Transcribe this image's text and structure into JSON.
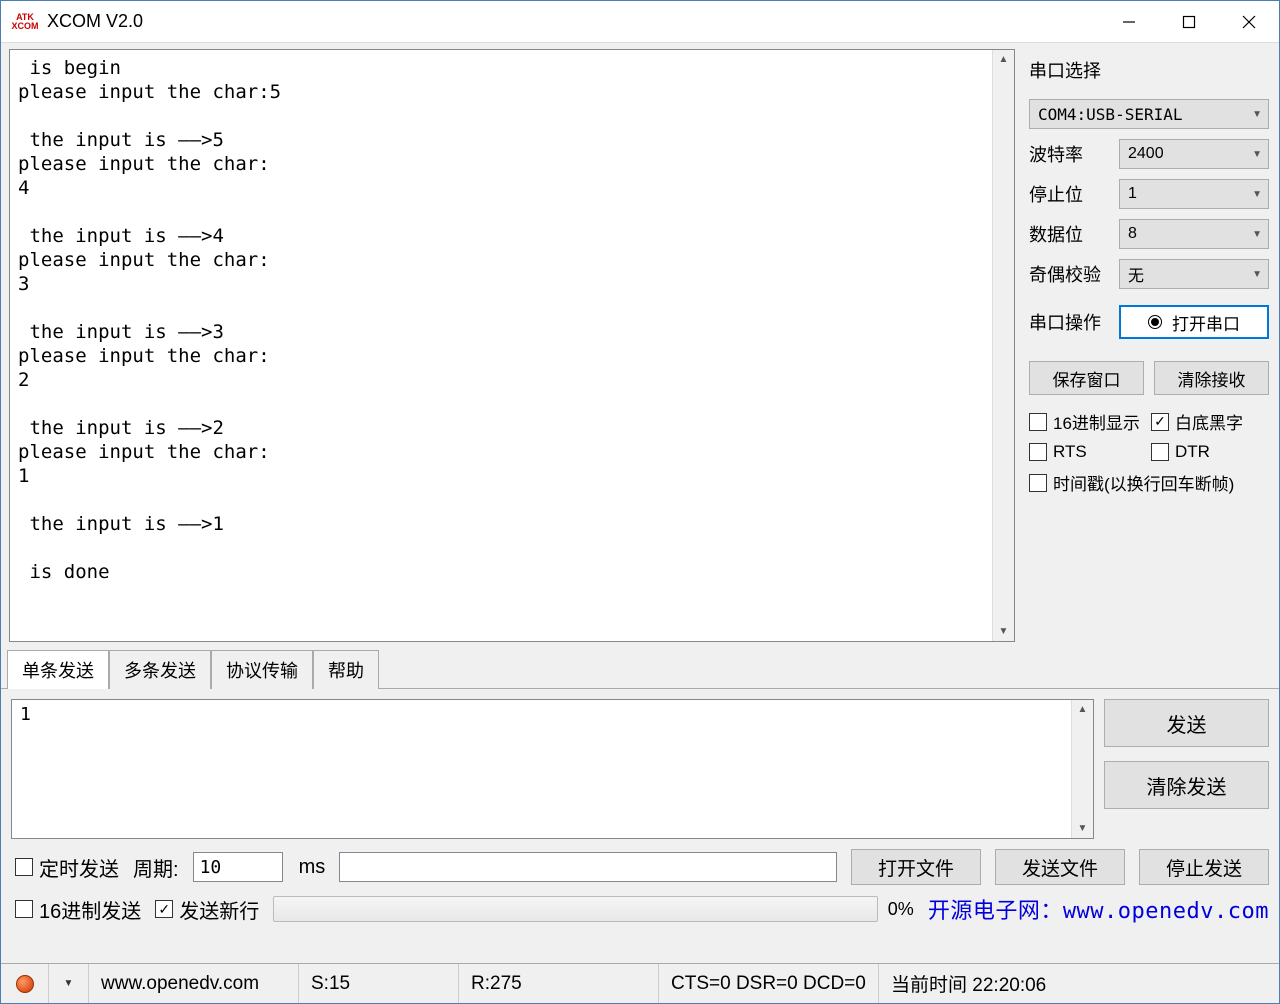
{
  "title": "XCOM V2.0",
  "logo": {
    "l1": "ATK",
    "l2": "XCOM"
  },
  "terminal": " is begin\nplease input the char:5\n\n the input is ——>5\nplease input the char:\n4\n\n the input is ——>4\nplease input the char:\n3\n\n the input is ——>3\nplease input the char:\n2\n\n the input is ——>2\nplease input the char:\n1\n\n the input is ——>1\n\n is done",
  "side": {
    "title": "串口选择",
    "port": "COM4:USB-SERIAL",
    "baud_lbl": "波特率",
    "baud": "2400",
    "stop_lbl": "停止位",
    "stop": "1",
    "data_lbl": "数据位",
    "data": "8",
    "parity_lbl": "奇偶校验",
    "parity": "无",
    "op_lbl": "串口操作",
    "op_btn": "打开串口",
    "save_btn": "保存窗口",
    "clear_btn": "清除接收",
    "hex_disp": "16进制显示",
    "bw": "白底黑字",
    "rts": "RTS",
    "dtr": "DTR",
    "ts": "时间戳(以换行回车断帧)"
  },
  "tabs": [
    "单条发送",
    "多条发送",
    "协议传输",
    "帮助"
  ],
  "send": {
    "text": "1",
    "send_btn": "发送",
    "clear_btn": "清除发送"
  },
  "opts": {
    "timed": "定时发送",
    "period_lbl": "周期:",
    "period_val": "10",
    "unit": "ms",
    "open_file": "打开文件",
    "send_file": "发送文件",
    "stop_send": "停止发送",
    "hex_send": "16进制发送",
    "newline": "发送新行",
    "pct": "0%",
    "link": "开源电子网：www.openedv.com"
  },
  "status": {
    "url": "www.openedv.com",
    "s": "S:15",
    "r": "R:275",
    "signals": "CTS=0 DSR=0 DCD=0",
    "time": "当前时间 22:20:06"
  }
}
